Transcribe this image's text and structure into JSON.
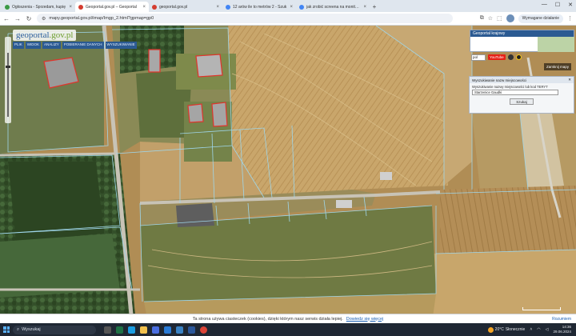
{
  "browser": {
    "tabs": [
      {
        "title": "Ogłoszenia - Sprzedam, kupię",
        "color": "#3b9a46",
        "active": false
      },
      {
        "title": "Geoportal.gov.pl – Geoportal",
        "color": "#d43c2f",
        "active": true
      },
      {
        "title": "geoportal.gov.pl",
        "color": "#d43c2f",
        "active": false
      },
      {
        "title": "12 arów ile to metrów 2 - Szuk",
        "color": "#4285f4",
        "active": false
      },
      {
        "title": "jak zrobić screena na monitorze",
        "color": "#4285f4",
        "active": false
      }
    ],
    "tab_close": "×",
    "new_tab": "+",
    "window_controls": [
      "—",
      "☐",
      "✕"
    ],
    "url": "mapy.geoportal.gov.pl/imap/Imgp_2.html?gpmap=gp0",
    "sync_label": "Wymagane działanie"
  },
  "geoportal": {
    "logo_left": "geoportal",
    "logo_right": ".gov.pl",
    "menu": [
      "PLIK",
      "WIDOK",
      "ANALIZY",
      "POBIERANIE DANYCH",
      "WYSZUKIWANIE"
    ],
    "panel_title": "Geoportal krajowy",
    "lang_select": "pol",
    "youtube": "YouTube",
    "close_map_label": "Zamknij mapy",
    "search": {
      "title": "Wyszukiwanie nazw miejscowości",
      "label": "Wyszukiwanie nazwy miejscowości lub kod TERYT",
      "value": "Starzenice Gaudki",
      "button": "Szukaj"
    }
  },
  "cookies": {
    "text": "Ta strona używa ciasteczek (cookies), dzięki którym nasz serwis działa lepiej.",
    "link": "Dowiedz się więcej",
    "accept": "Rozumiem"
  },
  "taskbar": {
    "search_placeholder": "Wyszukaj",
    "weather_temp": "20°C",
    "weather_text": "Słonecznie",
    "time": "14:36",
    "date": "29.06.2024"
  },
  "colors": {
    "field_light": "#c9a66b",
    "field_dark": "#a07b45",
    "vegetation": "#3d5a2a",
    "road": "#c8c3b6",
    "parcel_line": "#9fd6ea",
    "building_outline": "#e0342c"
  }
}
